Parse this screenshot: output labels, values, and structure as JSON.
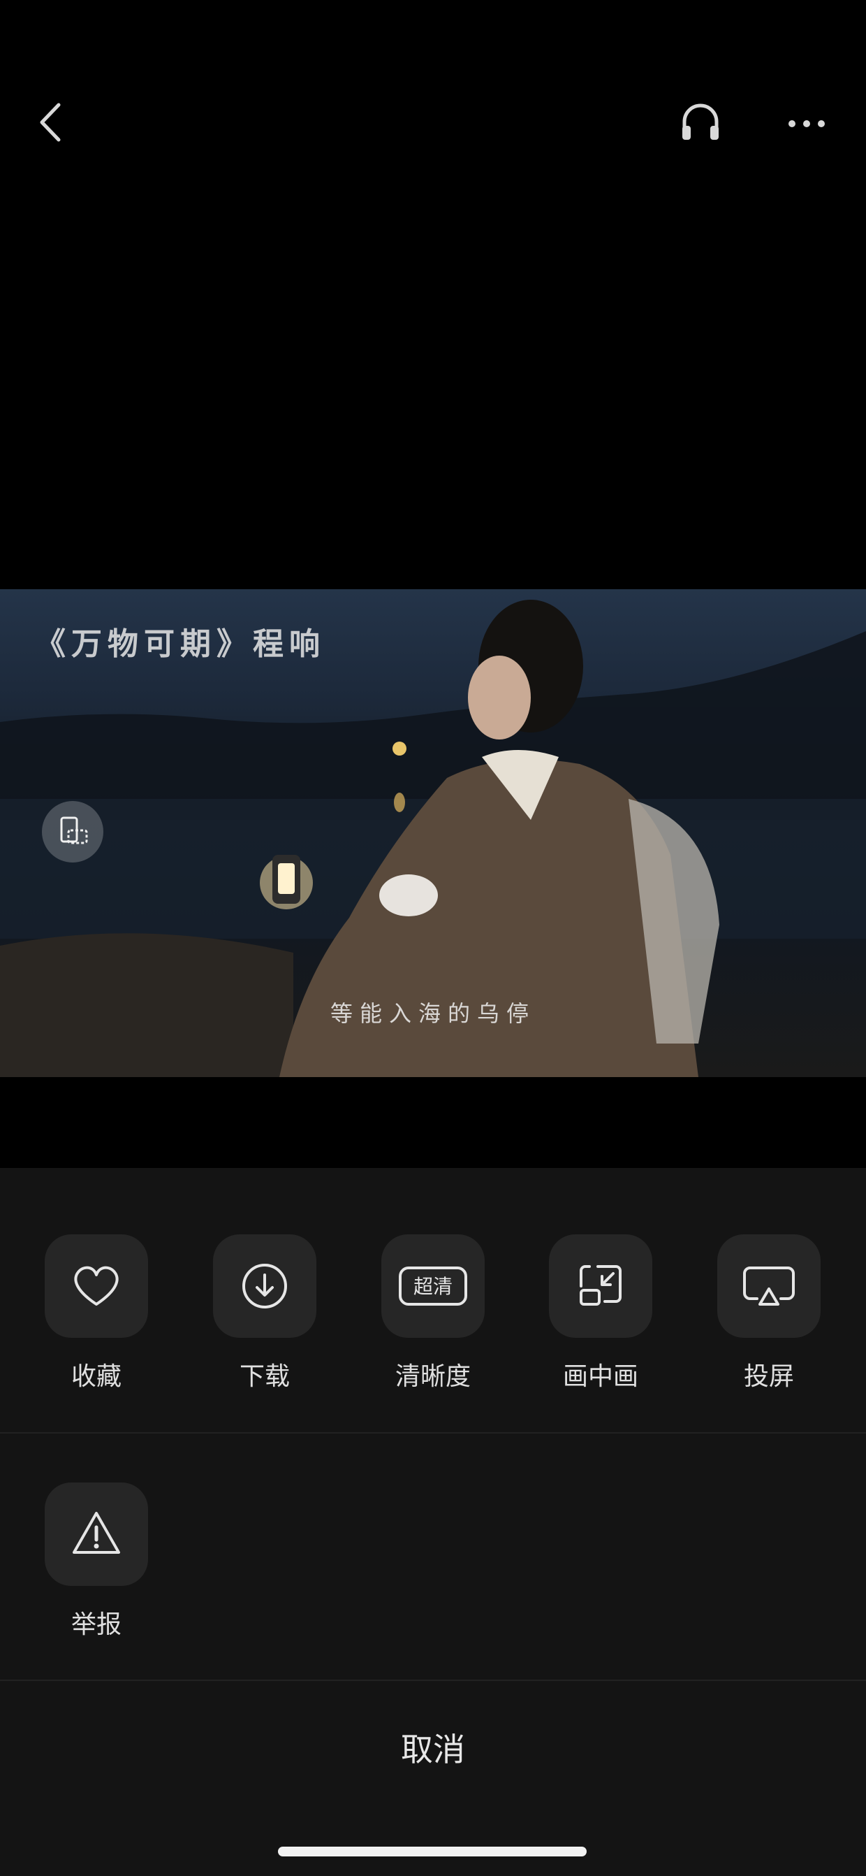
{
  "video": {
    "title_overlay": "《万物可期》程响",
    "subtitle": "等能入海的乌停"
  },
  "actions_row1": [
    {
      "label": "收藏",
      "icon": "heart-icon"
    },
    {
      "label": "下载",
      "icon": "download-icon"
    },
    {
      "label": "清晰度",
      "icon": "quality-icon",
      "badge": "超清"
    },
    {
      "label": "画中画",
      "icon": "picture-in-picture-icon"
    },
    {
      "label": "投屏",
      "icon": "cast-icon"
    }
  ],
  "actions_row2": [
    {
      "label": "举报",
      "icon": "warning-icon"
    }
  ],
  "cancel_label": "取消",
  "colors": {
    "background": "#000000",
    "sheet": "#141414",
    "icon_tile": "#262626",
    "text": "#e0e0e0"
  }
}
